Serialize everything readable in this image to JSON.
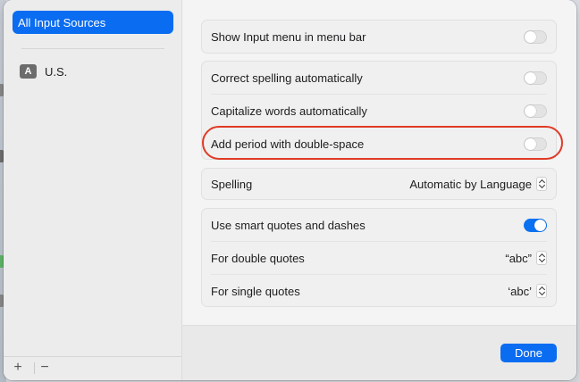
{
  "sidebar": {
    "selected_item": "All Input Sources",
    "items": [
      {
        "badge": "A",
        "label": "U.S."
      }
    ],
    "add_button": "+",
    "remove_button": "−"
  },
  "settings": {
    "show_input_menu": {
      "label": "Show Input menu in menu bar",
      "on": false
    },
    "correct_spelling": {
      "label": "Correct spelling automatically",
      "on": false
    },
    "capitalize_words": {
      "label": "Capitalize words automatically",
      "on": false
    },
    "add_period": {
      "label": "Add period with double-space",
      "on": false
    },
    "spelling": {
      "label": "Spelling",
      "value": "Automatic by Language"
    },
    "smart_quotes": {
      "label": "Use smart quotes and dashes",
      "on": true
    },
    "double_quotes": {
      "label": "For double quotes",
      "value": "“abc”"
    },
    "single_quotes": {
      "label": "For single quotes",
      "value": "‘abc’"
    }
  },
  "footer": {
    "done_label": "Done"
  },
  "colors": {
    "accent": "#0a6cf1",
    "highlight": "#e03a26"
  }
}
